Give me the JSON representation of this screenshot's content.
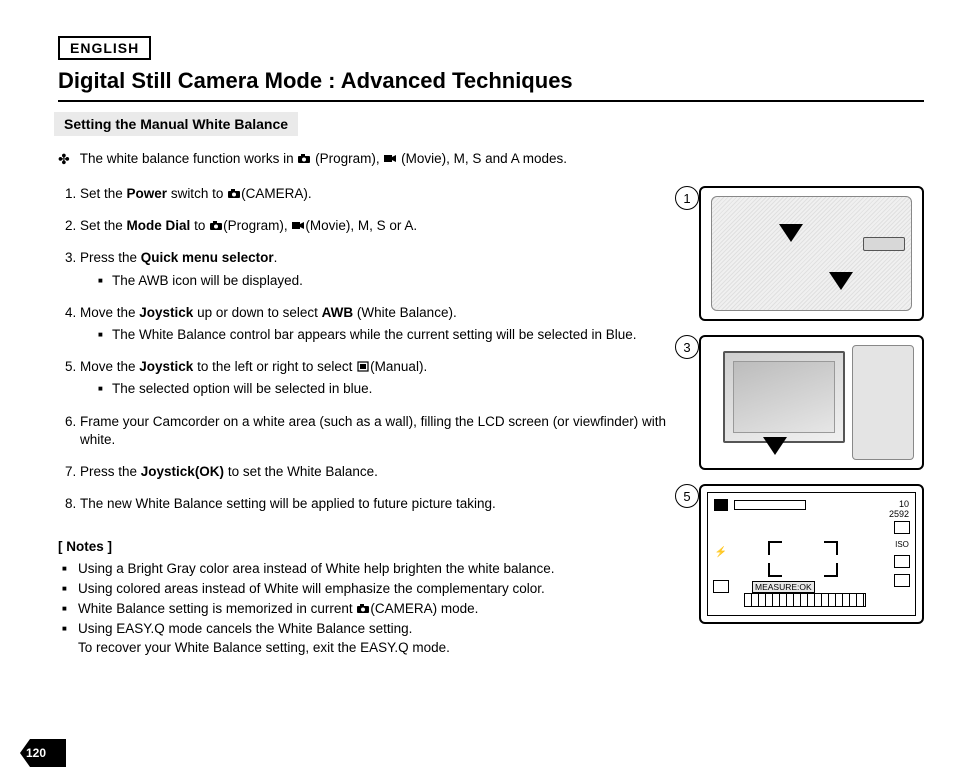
{
  "lang_label": "ENGLISH",
  "title": "Digital Still Camera Mode : Advanced Techniques",
  "subhead": "Setting the Manual White Balance",
  "intro": {
    "pre": "The white balance function works in ",
    "mid1": "(Program), ",
    "mid2": "(Movie), M, S and A modes."
  },
  "steps": [
    {
      "parts": [
        "Set the ",
        {
          "b": "Power"
        },
        " switch to ",
        {
          "icon": "camera"
        },
        "(CAMERA)."
      ]
    },
    {
      "parts": [
        "Set the ",
        {
          "b": "Mode Dial"
        },
        " to ",
        {
          "icon": "camera"
        },
        "(Program),  ",
        {
          "icon": "movie"
        },
        "(Movie), M, S or A."
      ]
    },
    {
      "parts": [
        "Press the ",
        {
          "b": "Quick menu selector"
        },
        "."
      ],
      "sub": [
        "The AWB icon will be displayed."
      ]
    },
    {
      "parts": [
        "Move the ",
        {
          "b": "Joystick"
        },
        " up or down to select ",
        {
          "b": "AWB"
        },
        " (White Balance)."
      ],
      "sub": [
        "The White Balance control bar appears while the current setting will be selected in Blue."
      ]
    },
    {
      "parts": [
        "Move the ",
        {
          "b": "Joystick"
        },
        " to the left or right to select  ",
        {
          "icon": "manual"
        },
        "(Manual)."
      ],
      "sub": [
        "The selected option will be selected in blue."
      ]
    },
    {
      "parts": [
        "Frame your Camcorder on a white area (such as a wall), filling the LCD screen (or viewfinder) with white."
      ]
    },
    {
      "parts": [
        "Press the ",
        {
          "b": "Joystick(OK)"
        },
        " to set the White Balance."
      ]
    },
    {
      "parts": [
        "The new White Balance setting will be applied to future picture taking."
      ]
    }
  ],
  "notes_head": "[ Notes ]",
  "notes": [
    "Using a Bright Gray color area instead of White help brighten the white balance.",
    "Using colored areas instead of White will emphasize the complementary color.",
    {
      "parts": [
        "White Balance setting is memorized in current ",
        {
          "icon": "camera"
        },
        "(CAMERA) mode."
      ]
    },
    "Using EASY.Q mode cancels the White Balance setting.\nTo recover your White Balance setting, exit the EASY.Q mode."
  ],
  "figures": {
    "f1": "1",
    "f3": "3",
    "f5": "5",
    "lcd": {
      "top_right_1": "10",
      "top_right_2": "2592",
      "iso": "ISO",
      "measure": "MEASURE:OK"
    }
  },
  "page_number": "120"
}
